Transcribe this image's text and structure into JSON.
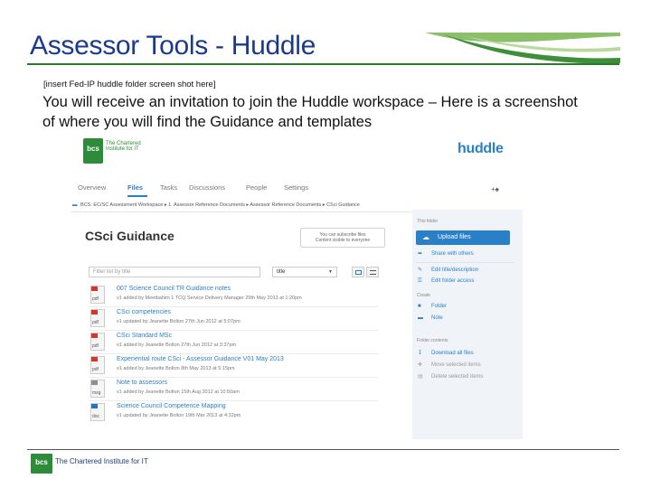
{
  "slide": {
    "title": "Assessor Tools - Huddle",
    "placeholder_note": "[insert Fed-IP huddle folder screen shot here]",
    "body": "You will receive an invitation to join the Huddle workspace – Here is a screenshot of where you will find the Guidance and templates",
    "footer": {
      "logo_text": "bcs",
      "org_name": "The Chartered Institute for IT"
    }
  },
  "screenshot": {
    "bcs_logo_text": "bcs",
    "bcs_tagline": "The Chartered Institute for IT",
    "product_logo": "huddle",
    "tabs": [
      {
        "label": "Overview",
        "active": false
      },
      {
        "label": "Files",
        "active": true
      },
      {
        "label": "Tasks",
        "active": false
      },
      {
        "label": "Discussions",
        "active": false
      },
      {
        "label": "People",
        "active": false
      },
      {
        "label": "Settings",
        "active": false
      }
    ],
    "breadcrumb": [
      "BCS: EC/SC Assessment Workspace",
      "1. Assessor Reference Documents",
      "Assessor Reference Documents",
      "CSci Guidance"
    ],
    "folder_title": "CSci Guidance",
    "subscription_note": {
      "line1": "You can subscribe files",
      "line2": "Content visible to everyone"
    },
    "filter_placeholder": "Filter list by title",
    "sort_value": "title",
    "files": [
      {
        "name": "007 Science Council TR Guidance notes",
        "meta": "v1 added by Meetbahim 1 TCQ Service Delivery Manager 29th May 2013 at 1:20pm",
        "ext": "pdf",
        "band": "#d9342b"
      },
      {
        "name": "CSci competencies",
        "meta": "v1 updated by Jeanette Bolton 27th Jun 2012 at 5:07pm",
        "ext": "pdf",
        "band": "#d9342b"
      },
      {
        "name": "CSci Standard MSc",
        "meta": "v1 added by Jeanette Bolton 27th Jun 2012 at 3:37pm",
        "ext": "pdf",
        "band": "#d9342b"
      },
      {
        "name": "Experiential route CSci - Assessor Guidance V01 May 2013",
        "meta": "v1 added by Jeanette Bolton 8th May 2013 at 5:15pm",
        "ext": "pdf",
        "band": "#d9342b"
      },
      {
        "name": "Note to assessors",
        "meta": "v1 added by Jeanette Bolton 15th Aug 2012 at 10:50am",
        "ext": "msg",
        "band": "#8a8f99"
      },
      {
        "name": "Science Council Competence Mapping",
        "meta": "v1 updated by Jeanette Bolton 19th Mar 2013 at 4:32pm",
        "ext": "doc",
        "band": "#2a6fc9"
      }
    ],
    "sidebar": {
      "this_folder_heading": "This folder",
      "upload_label": "Upload files",
      "share_label": "Share with others",
      "edit_title_label": "Edit title/description",
      "edit_access_label": "Edit folder access",
      "create_heading": "Create",
      "folder_label": "Folder",
      "note_label": "Note",
      "contents_heading": "Folder contents",
      "download_label": "Download all files",
      "move_label": "Move selected items",
      "delete_label": "Delete selected items"
    },
    "colors": {
      "accent": "#2a7fc9",
      "brand_green": "#2e8b3a",
      "title_blue": "#1a3a8c"
    }
  }
}
